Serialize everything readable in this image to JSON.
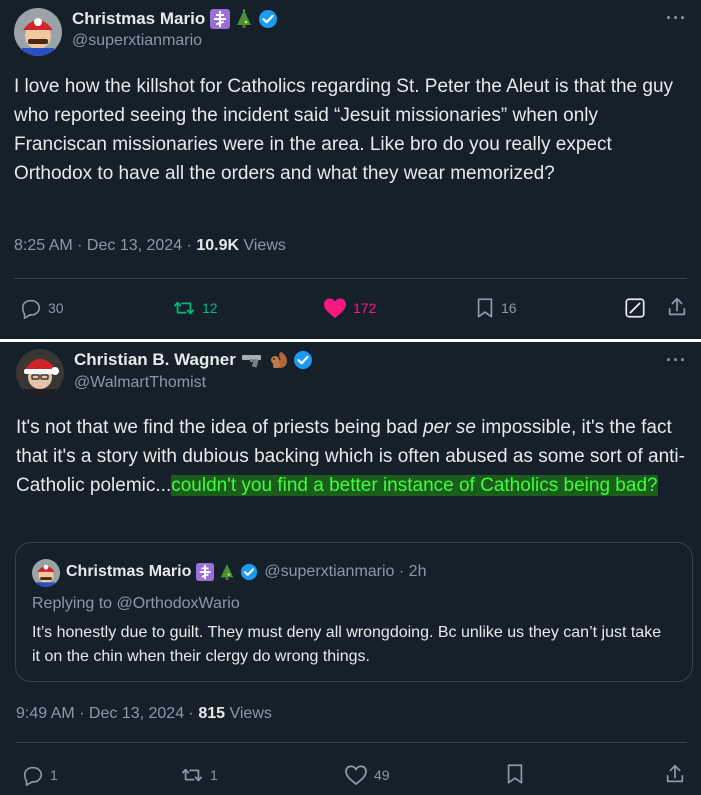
{
  "tweet1": {
    "display_name": "Christmas Mario",
    "handle": "@superxtianmario",
    "text": "I love how the killshot for Catholics regarding St. Peter the Aleut is that the guy who reported seeing the incident said “Jesuit missionaries” when only Franciscan missionaries were in the area. Like bro do you really expect Orthodox to have all the orders and what they wear memorized?",
    "time": "8:25 AM · Dec 13, 2024 · ",
    "views_count": "10.9K",
    "views_label": " Views",
    "more": "···",
    "actions": {
      "replies": "30",
      "retweets": "12",
      "likes": "172",
      "bookmarks": "16"
    },
    "colors": {
      "retweet": "#00ba7c",
      "like": "#f91880",
      "verified": "#1d9bf0"
    }
  },
  "tweet2": {
    "display_name": "Christian B. Wagner",
    "handle": "@WalmartThomist",
    "text_part1": "It's not that we find the idea of priests being bad ",
    "text_italic": "per se",
    "text_part2": " impossible, it's the fact that it's a story with dubious backing which is often abused as some sort of anti-Catholic polemic...",
    "text_highlight": "couldn't you find a better instance of Catholics being bad?",
    "time": "9:49 AM · Dec 13, 2024 · ",
    "views_count": "815",
    "views_label": " Views",
    "more": "···",
    "quote": {
      "display_name": "Christmas Mario",
      "handle_time": "@superxtianmario · 2h",
      "replying_to": "Replying to @OrthodoxWario",
      "text": "It’s honestly due to guilt. They must deny all wrongdoing. Bc unlike us they can’t just take it on the chin when their clergy do wrong things."
    },
    "actions": {
      "replies": "1",
      "retweets": "1",
      "likes": "49"
    },
    "colors": {
      "highlight_bg": "#1b5e1b",
      "highlight_text": "#3cff3c"
    }
  }
}
